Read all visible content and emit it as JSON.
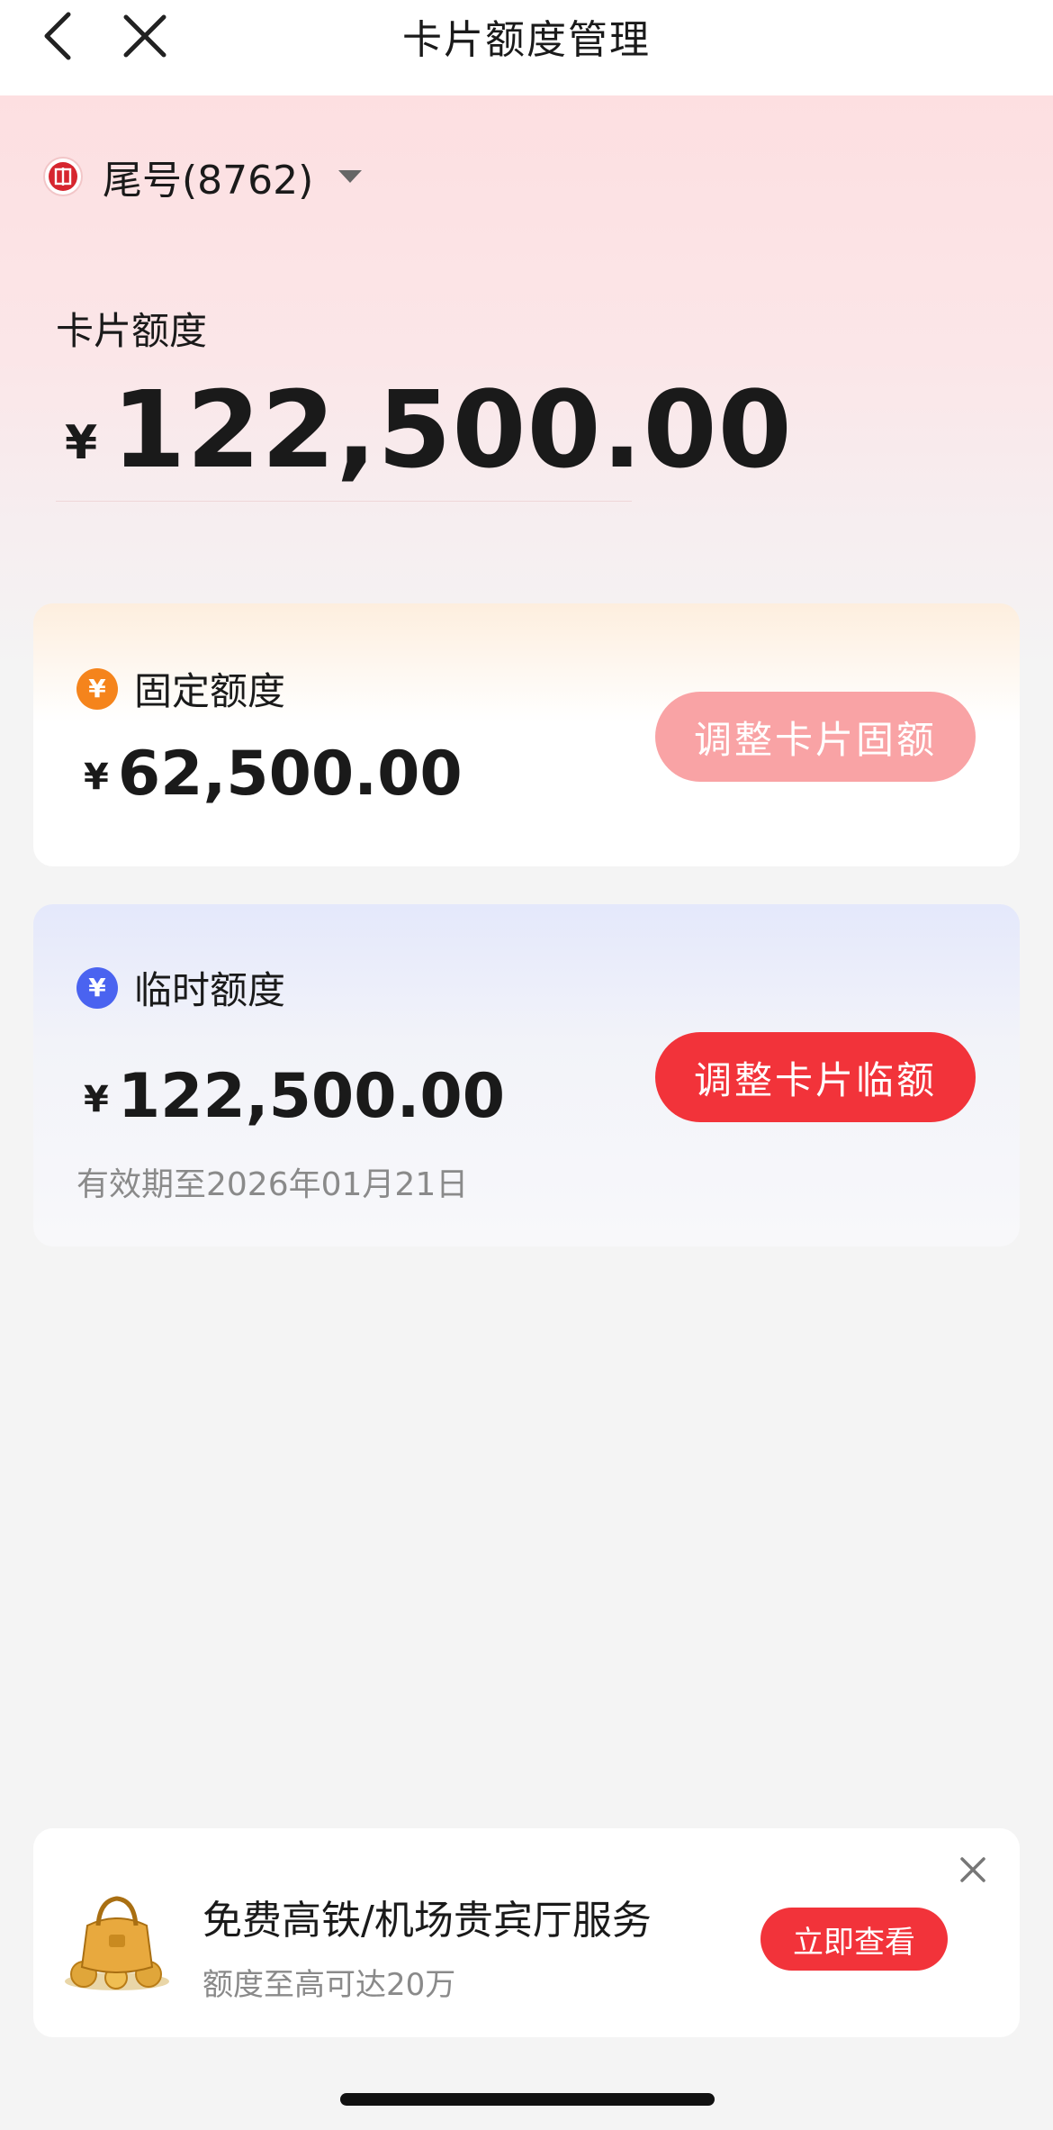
{
  "nav": {
    "title": "卡片额度管理"
  },
  "card_selector": {
    "label": "尾号(8762)"
  },
  "total_limit": {
    "label": "卡片额度",
    "currency": "¥",
    "amount": "122,500.00"
  },
  "fixed_limit": {
    "title": "固定额度",
    "icon": "yuan-coin-icon",
    "icon_color": "#f5841c",
    "currency": "¥",
    "amount": "62,500.00",
    "button_label": "调整卡片固额",
    "button_color": "#f9a3a5"
  },
  "temp_limit": {
    "title": "临时额度",
    "icon": "yuan-coin-icon",
    "icon_color": "#4a63f0",
    "currency": "¥",
    "amount": "122,500.00",
    "expiry": "有效期至2026年01月21日",
    "button_label": "调整卡片临额",
    "button_color": "#f2333a"
  },
  "promo": {
    "title": "免费高铁/机场贵宾厅服务",
    "subtitle": "额度至高可达20万",
    "button_label": "立即查看",
    "icon": "gold-bag-icon"
  },
  "colors": {
    "accent": "#f2333a",
    "background": "#f4f4f4"
  }
}
